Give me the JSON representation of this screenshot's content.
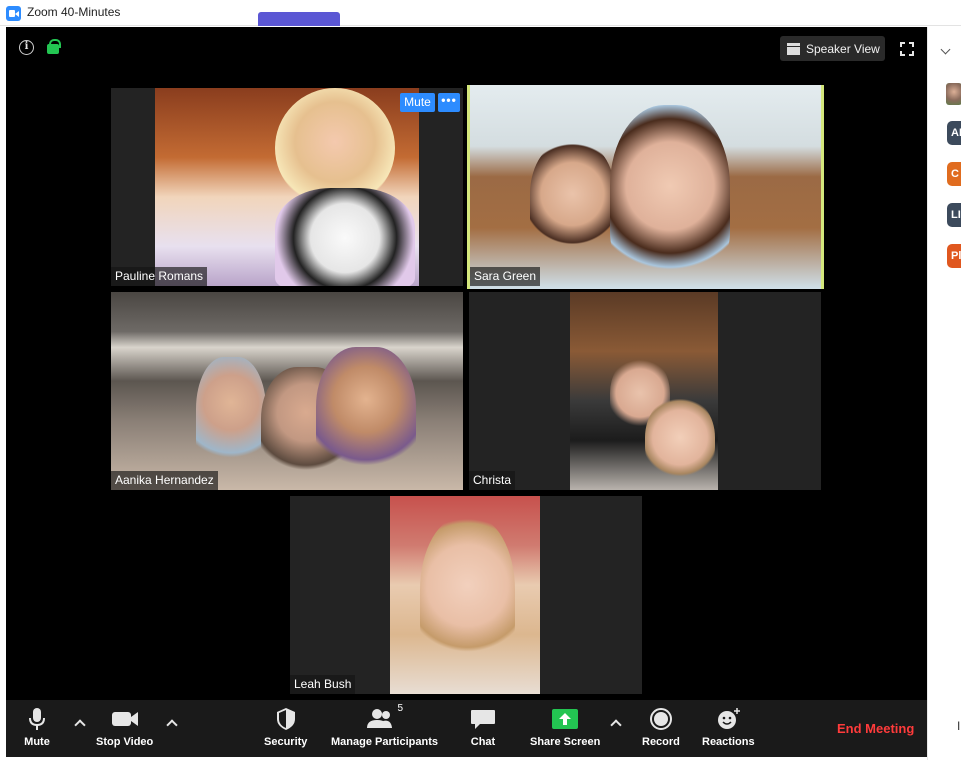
{
  "window": {
    "title": "Zoom 40-Minutes"
  },
  "header": {
    "speaker_view_label": "Speaker View"
  },
  "participants": [
    {
      "name": "Pauline Romans"
    },
    {
      "name": "Sara Green",
      "active_speaker": true
    },
    {
      "name": "Aanika Hernandez"
    },
    {
      "name": "Christa"
    },
    {
      "name": "Leah Bush"
    }
  ],
  "tile_hover": {
    "mute_label": "Mute",
    "more_label": "•••"
  },
  "toolbar": {
    "mute_label": "Mute",
    "stop_video_label": "Stop Video",
    "security_label": "Security",
    "manage_participants_label": "Manage Participants",
    "participant_count": "5",
    "chat_label": "Chat",
    "share_screen_label": "Share Screen",
    "record_label": "Record",
    "reactions_label": "Reactions",
    "end_meeting_label": "End Meeting"
  },
  "sidebar": {
    "avatars": [
      {
        "initials": "AI",
        "color": "#3c4a5c"
      },
      {
        "initials": "C",
        "color": "#e06c1f"
      },
      {
        "initials": "LI",
        "color": "#3c4a5c"
      },
      {
        "initials": "Pl",
        "color": "#e0571f"
      }
    ],
    "more_text": "I"
  },
  "colors": {
    "active_speaker_border": "#d4e77c",
    "end_meeting": "#ff3b3b",
    "share_screen": "#23c552",
    "accent": "#2d8cff"
  }
}
